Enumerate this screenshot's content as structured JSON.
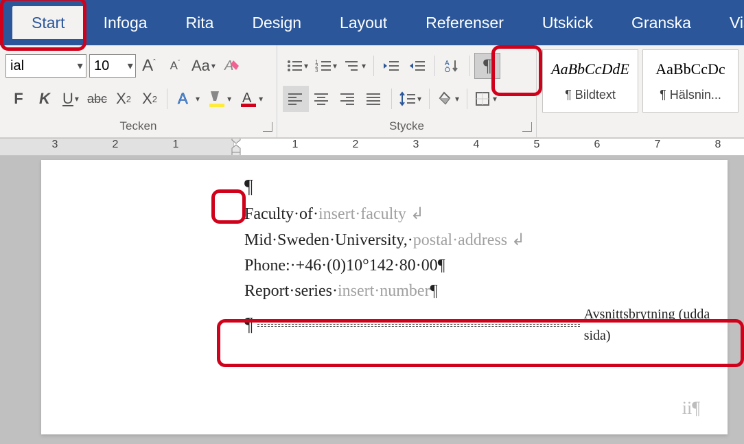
{
  "tabs": {
    "start": "Start",
    "infoga": "Infoga",
    "rita": "Rita",
    "design": "Design",
    "layout": "Layout",
    "referenser": "Referenser",
    "utskick": "Utskick",
    "granska": "Granska",
    "visa": "Vis"
  },
  "font": {
    "name_value": "ial",
    "size_value": "10"
  },
  "group_labels": {
    "tecken": "Tecken",
    "stycke": "Stycke"
  },
  "buttons": {
    "bold": "F",
    "italic": "K",
    "underline": "U",
    "strike_label": "abc",
    "subscript": "X",
    "subscript_sub": "2",
    "superscript": "X",
    "superscript_sup": "2"
  },
  "styles": {
    "bildtext_preview": "AaBbCcDdE",
    "bildtext_name": "¶ Bildtext",
    "halsning_preview": "AaBbCcDc",
    "halsning_name": "¶ Hälsnin..."
  },
  "ruler": {
    "ticks": [
      "3",
      "2",
      "1",
      "1",
      "2",
      "3",
      "4",
      "5",
      "6",
      "7",
      "8"
    ]
  },
  "document": {
    "line1_pilcrow": "¶",
    "line2_prefix": "Faculty·of·",
    "line2_gray": "insert·faculty",
    "line2_mark": " ↲",
    "line3_prefix": "Mid·Sweden·University,·",
    "line3_gray": "postal·address",
    "line3_mark": " ↲",
    "line4": "Phone:·+46·(0)10°142·80·00¶",
    "line5_prefix": "Report·series·",
    "line5_gray": "insert·number",
    "line5_mark": "¶",
    "section_pilcrow": "¶",
    "section_label": "Avsnittsbrytning (udda sida)",
    "pagenum": "ii¶"
  }
}
